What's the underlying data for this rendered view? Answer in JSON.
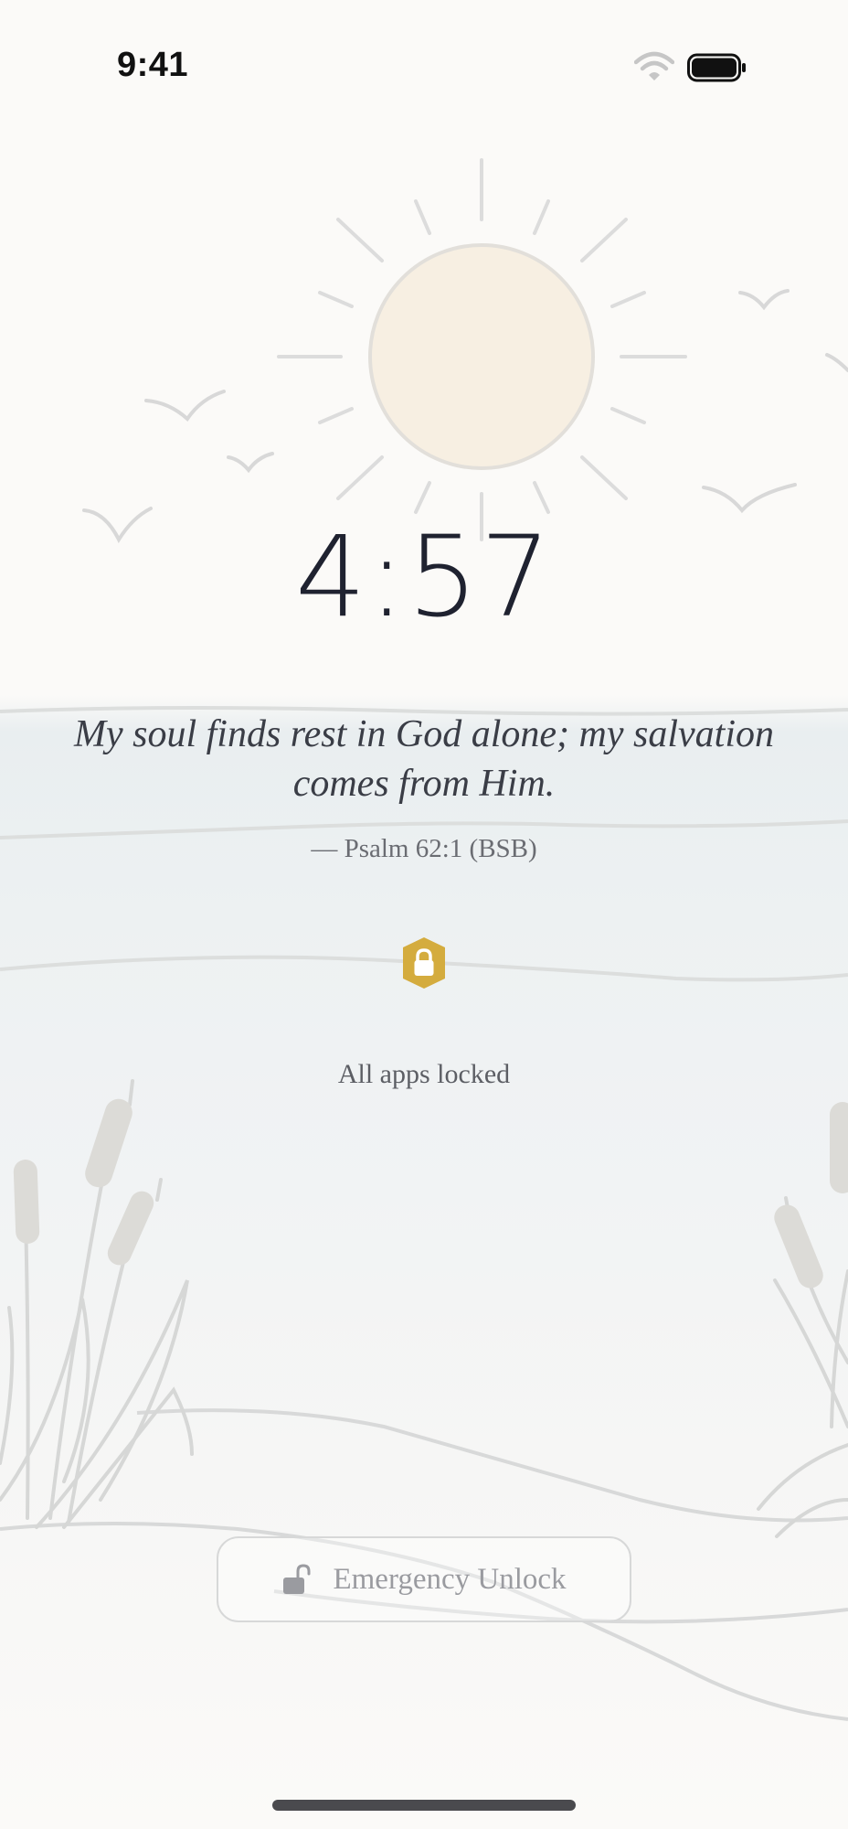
{
  "status_bar": {
    "time": "9:41",
    "wifi_icon": "wifi-icon",
    "battery_icon": "battery-icon"
  },
  "lock_screen": {
    "timer": "4:57",
    "verse_text": "My soul finds rest in God alone; my salvation comes from Him.",
    "verse_reference": "— Psalm 62:1 (BSB)",
    "lock_icon": "shield-lock-icon",
    "status_text": "All apps locked"
  },
  "emergency": {
    "label": "Emergency Unlock",
    "icon": "unlock-icon"
  },
  "colors": {
    "accent_gold": "#d4ac3e",
    "text_dark": "#1f2230",
    "button_text": "#9a9ba0",
    "sun_fill": "#f7efe2"
  }
}
